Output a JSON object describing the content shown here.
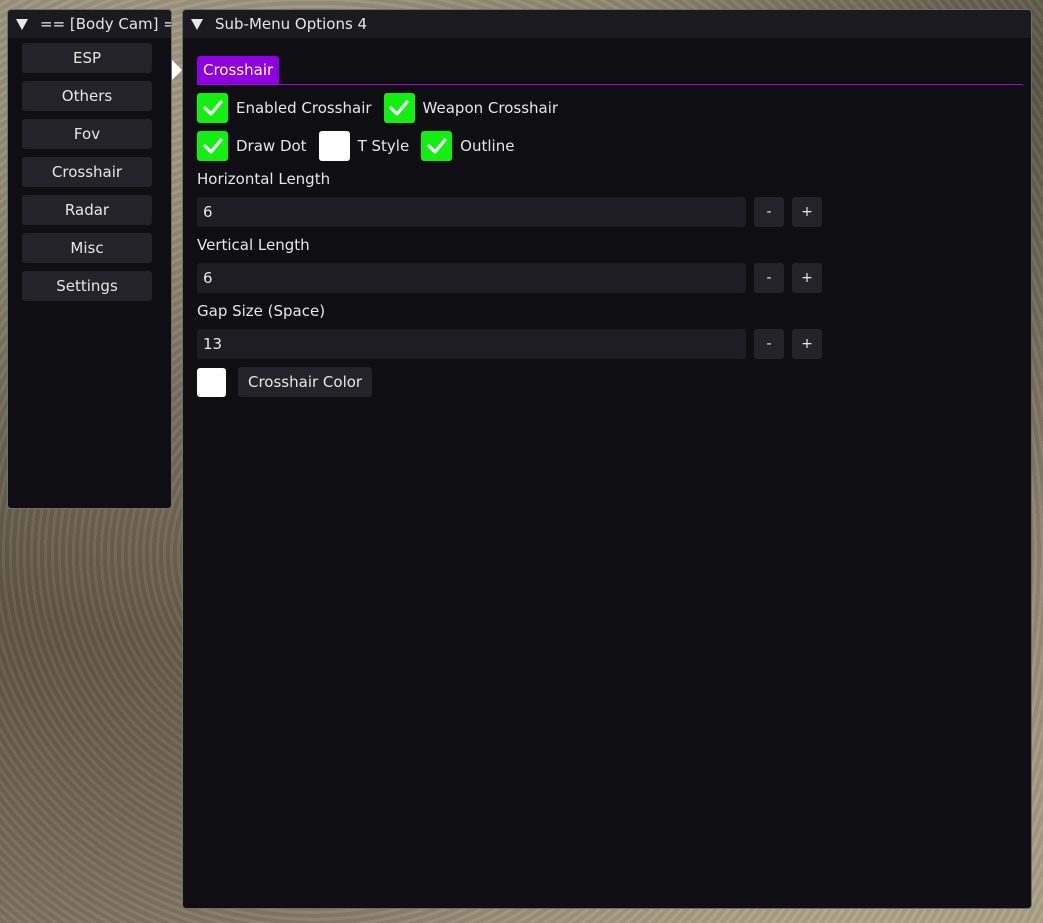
{
  "main_window": {
    "title": "== [Body Cam] ==",
    "items": [
      {
        "label": "ESP"
      },
      {
        "label": "Others"
      },
      {
        "label": "Fov"
      },
      {
        "label": "Crosshair"
      },
      {
        "label": "Radar"
      },
      {
        "label": "Misc"
      },
      {
        "label": "Settings"
      }
    ]
  },
  "sub_window": {
    "title": "Sub-Menu Options 4",
    "tab_label": "Crosshair",
    "checkboxes": {
      "enabled_crosshair": {
        "label": "Enabled Crosshair",
        "checked": true
      },
      "weapon_crosshair": {
        "label": "Weapon Crosshair",
        "checked": true
      },
      "draw_dot": {
        "label": "Draw Dot",
        "checked": true
      },
      "t_style": {
        "label": "T Style",
        "checked": false
      },
      "outline": {
        "label": "Outline",
        "checked": true
      }
    },
    "horizontal_length": {
      "label": "Horizontal Length",
      "value": "6",
      "minus": "-",
      "plus": "+"
    },
    "vertical_length": {
      "label": "Vertical Length",
      "value": "6",
      "minus": "-",
      "plus": "+"
    },
    "gap_size": {
      "label": "Gap Size (Space)",
      "value": "13",
      "minus": "-",
      "plus": "+"
    },
    "color": {
      "label": "Crosshair Color",
      "swatch": "#ffffff"
    }
  },
  "colors": {
    "accent": "#8f00e0",
    "checkbox_on": "#11f011",
    "window_bg": "#0f0e13"
  }
}
